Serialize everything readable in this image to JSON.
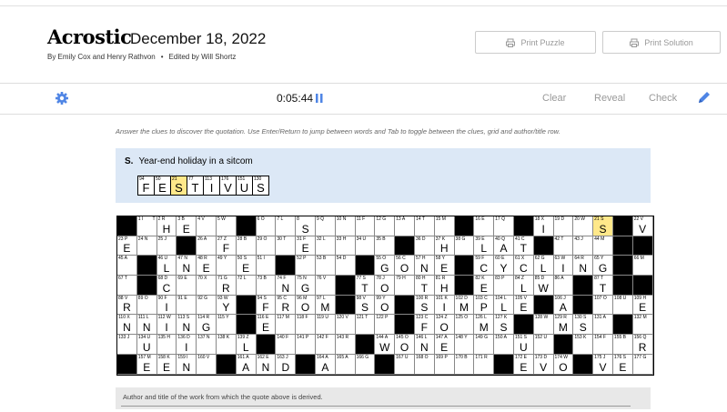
{
  "header": {
    "title": "Acrostic",
    "date": "December 18, 2022",
    "authors": "By Emily Cox and Henry Rathvon",
    "editor": "Edited by Will Shortz",
    "print_puzzle": "Print Puzzle",
    "print_solution": "Print Solution"
  },
  "toolbar": {
    "timer": "0:05:44",
    "clear": "Clear",
    "reveal": "Reveal",
    "check": "Check"
  },
  "instructions": "Answer the clues to discover the quotation. Use Enter/Return to jump between words and Tab to toggle between the clues, grid and author/title row.",
  "clue": {
    "letter": "S.",
    "text": "Year-end holiday in a sitcom",
    "cells": [
      {
        "num": "94",
        "letter": "F",
        "hl": false
      },
      {
        "num": "50",
        "letter": "E",
        "hl": false
      },
      {
        "num": "21",
        "letter": "S",
        "hl": true
      },
      {
        "num": "77",
        "letter": "T",
        "hl": false
      },
      {
        "num": "113",
        "letter": "I",
        "hl": false
      },
      {
        "num": "176",
        "letter": "V",
        "hl": false
      },
      {
        "num": "151",
        "letter": "U",
        "hl": false
      },
      {
        "num": "130",
        "letter": "S",
        "hl": false
      }
    ]
  },
  "grid_rows": [
    [
      [
        "B",
        "",
        ""
      ],
      [
        "1 I",
        "",
        "T"
      ],
      [
        "2 R",
        "H",
        ""
      ],
      [
        "3 B",
        "E",
        ""
      ],
      [
        "4 V",
        "",
        ""
      ],
      [
        "5 W",
        "",
        ""
      ],
      [
        "B",
        "",
        ""
      ],
      [
        "6 O",
        "",
        ""
      ],
      [
        "7 L",
        "",
        ""
      ],
      [
        "8",
        "S",
        ""
      ],
      [
        "9 Q",
        "",
        ""
      ],
      [
        "10 N",
        "",
        ""
      ],
      [
        "11 F",
        "",
        ""
      ],
      [
        "12 G",
        "",
        ""
      ],
      [
        "13 A",
        "",
        ""
      ],
      [
        "14 T",
        "",
        ""
      ],
      [
        "15 M",
        "",
        ""
      ],
      [
        "B",
        "",
        ""
      ],
      [
        "16 E",
        "",
        ""
      ],
      [
        "17 Q",
        "",
        ""
      ],
      [
        "B",
        "",
        ""
      ],
      [
        "18 X",
        "I",
        ""
      ],
      [
        "19 D",
        "",
        ""
      ],
      [
        "20 W",
        "",
        ""
      ],
      [
        "21 S",
        "S",
        "",
        1
      ],
      [
        "B",
        "",
        ""
      ],
      [
        "22 V",
        "V",
        ""
      ]
    ],
    [
      [
        "23 P",
        "E",
        ""
      ],
      [
        "24 N",
        "",
        ""
      ],
      [
        "25 J",
        "",
        ""
      ],
      [
        "B",
        "",
        ""
      ],
      [
        "26 A",
        "",
        ""
      ],
      [
        "27 Z",
        "F",
        ""
      ],
      [
        "28 B",
        "",
        ""
      ],
      [
        "29 O",
        "",
        ""
      ],
      [
        "30 T",
        "",
        ""
      ],
      [
        "31 F",
        "E",
        ""
      ],
      [
        "32 L",
        "",
        ""
      ],
      [
        "33 H",
        "",
        ""
      ],
      [
        "34 U",
        "",
        ""
      ],
      [
        "35 B",
        "",
        ""
      ],
      [
        "B",
        "",
        ""
      ],
      [
        "36 D",
        "",
        ""
      ],
      [
        "37 K",
        "H",
        ""
      ],
      [
        "38 G",
        "",
        ""
      ],
      [
        "39 E",
        "L",
        ""
      ],
      [
        "40 Q",
        "A",
        ""
      ],
      [
        "41 C",
        "T",
        ""
      ],
      [
        "B",
        "",
        ""
      ],
      [
        "42 T",
        "",
        ""
      ],
      [
        "43 J",
        "",
        ""
      ],
      [
        "44 M",
        "",
        ""
      ],
      [
        "B",
        "",
        ""
      ],
      [
        "B",
        "",
        ""
      ]
    ],
    [
      [
        "45 A",
        "",
        ""
      ],
      [
        "B",
        "",
        ""
      ],
      [
        "46 U",
        "L",
        ""
      ],
      [
        "47 N",
        "N",
        ""
      ],
      [
        "48 R",
        "E",
        ""
      ],
      [
        "49 Y",
        "",
        ""
      ],
      [
        "50 S",
        "E",
        ""
      ],
      [
        "51 I",
        "",
        ""
      ],
      [
        "B",
        "",
        ""
      ],
      [
        "52 P",
        "",
        ""
      ],
      [
        "53 B",
        "",
        ""
      ],
      [
        "54 D",
        "",
        ""
      ],
      [
        "B",
        "",
        ""
      ],
      [
        "55 O",
        "G",
        ""
      ],
      [
        "56 C",
        "O",
        ""
      ],
      [
        "57 H",
        "N",
        ""
      ],
      [
        "58 Y",
        "E",
        ""
      ],
      [
        "B",
        "",
        ""
      ],
      [
        "59 F",
        "C",
        ""
      ],
      [
        "60 E",
        "Y",
        ""
      ],
      [
        "61 X",
        "C",
        ""
      ],
      [
        "62 G",
        "L",
        ""
      ],
      [
        "63 W",
        "I",
        ""
      ],
      [
        "64 R",
        "N",
        ""
      ],
      [
        "65 Y",
        "G",
        ""
      ],
      [
        "B",
        "",
        ""
      ],
      [
        "66 M",
        "",
        ""
      ]
    ],
    [
      [
        "67 T",
        "",
        ""
      ],
      [
        "B",
        "",
        ""
      ],
      [
        "68 D",
        "C",
        ""
      ],
      [
        "69 E",
        "",
        ""
      ],
      [
        "70 X",
        "",
        ""
      ],
      [
        "71 G",
        "R",
        ""
      ],
      [
        "72 L",
        "",
        ""
      ],
      [
        "73 B",
        "",
        ""
      ],
      [
        "74 F",
        "N",
        ""
      ],
      [
        "75 N",
        "G",
        ""
      ],
      [
        "76 V",
        "",
        ""
      ],
      [
        "B",
        "",
        ""
      ],
      [
        "77 S",
        "T",
        ""
      ],
      [
        "78 J",
        "O",
        ""
      ],
      [
        "79 H",
        "",
        ""
      ],
      [
        "80 H",
        "T",
        ""
      ],
      [
        "81 R",
        "H",
        ""
      ],
      [
        "B",
        "",
        ""
      ],
      [
        "82 K",
        "E",
        ""
      ],
      [
        "83 P",
        "",
        ""
      ],
      [
        "84 Z",
        "L",
        ""
      ],
      [
        "85 D",
        "W",
        ""
      ],
      [
        "86 A",
        "",
        ""
      ],
      [
        "B",
        "",
        ""
      ],
      [
        "87 T",
        "T",
        ""
      ],
      [
        "B",
        "",
        ""
      ],
      [
        "B",
        "",
        ""
      ]
    ],
    [
      [
        "88 V",
        "R",
        ""
      ],
      [
        "89 O",
        "",
        ""
      ],
      [
        "90 F",
        "I",
        ""
      ],
      [
        "91 E",
        "",
        ""
      ],
      [
        "92 G",
        "",
        ""
      ],
      [
        "93 W",
        "Y",
        ""
      ],
      [
        "B",
        "",
        ""
      ],
      [
        "94 S",
        "F",
        ""
      ],
      [
        "95 C",
        "R",
        ""
      ],
      [
        "96 M",
        "O",
        ""
      ],
      [
        "97 L",
        "M",
        ""
      ],
      [
        "B",
        "",
        ""
      ],
      [
        "98 V",
        "S",
        ""
      ],
      [
        "99 Y",
        "O",
        ""
      ],
      [
        "B",
        "",
        ""
      ],
      [
        "100 R",
        "S",
        ""
      ],
      [
        "101 K",
        "I",
        ""
      ],
      [
        "102 D",
        "M",
        ""
      ],
      [
        "103 C",
        "P",
        ""
      ],
      [
        "104 L",
        "L",
        ""
      ],
      [
        "105 V",
        "E",
        ""
      ],
      [
        "B",
        "",
        ""
      ],
      [
        "106 J",
        "A",
        ""
      ],
      [
        "B",
        "",
        ""
      ],
      [
        "107 O",
        "",
        ""
      ],
      [
        "108 U",
        "",
        ""
      ],
      [
        "109 H",
        "E",
        ""
      ]
    ],
    [
      [
        "110 X",
        "N",
        ""
      ],
      [
        "111 L",
        "N",
        ""
      ],
      [
        "112 W",
        "I",
        ""
      ],
      [
        "113 S",
        "N",
        ""
      ],
      [
        "114 R",
        "G",
        ""
      ],
      [
        "115 Y",
        "",
        ""
      ],
      [
        "B",
        "",
        ""
      ],
      [
        "116 E",
        "E",
        ""
      ],
      [
        "117 M",
        "",
        ""
      ],
      [
        "118 F",
        "",
        ""
      ],
      [
        "119 U",
        "",
        ""
      ],
      [
        "120 V",
        "",
        ""
      ],
      [
        "121 T",
        "",
        ""
      ],
      [
        "122 P",
        "",
        ""
      ],
      [
        "B",
        "",
        ""
      ],
      [
        "123 C",
        "F",
        ""
      ],
      [
        "124 Z",
        "O",
        ""
      ],
      [
        "125 O",
        "",
        ""
      ],
      [
        "126 L",
        "M",
        ""
      ],
      [
        "127 K",
        "S",
        ""
      ],
      [
        "B",
        "",
        ""
      ],
      [
        "128 W",
        "",
        ""
      ],
      [
        "129 R",
        "M",
        ""
      ],
      [
        "130 S",
        "S",
        ""
      ],
      [
        "131 A",
        "",
        ""
      ],
      [
        "B",
        "",
        ""
      ],
      [
        "132 M",
        "",
        ""
      ]
    ],
    [
      [
        "133 J",
        "",
        ""
      ],
      [
        "134 U",
        "U",
        ""
      ],
      [
        "135 H",
        "",
        ""
      ],
      [
        "136 D",
        "I",
        ""
      ],
      [
        "137 N",
        "",
        ""
      ],
      [
        "138 K",
        "",
        ""
      ],
      [
        "139 Z",
        "L",
        ""
      ],
      [
        "B",
        "",
        ""
      ],
      [
        "140 F",
        "",
        ""
      ],
      [
        "141 P",
        "",
        ""
      ],
      [
        "142 F",
        "",
        ""
      ],
      [
        "143 R",
        "",
        ""
      ],
      [
        "B",
        "",
        ""
      ],
      [
        "144 A",
        "W",
        ""
      ],
      [
        "145 O",
        "O",
        ""
      ],
      [
        "146 L",
        "N",
        ""
      ],
      [
        "147 A",
        "E",
        ""
      ],
      [
        "148 Y",
        "",
        ""
      ],
      [
        "149 G",
        "",
        ""
      ],
      [
        "150 A",
        "",
        ""
      ],
      [
        "151 S",
        "U",
        ""
      ],
      [
        "152 U",
        "",
        ""
      ],
      [
        "B",
        "",
        ""
      ],
      [
        "153 K",
        "",
        ""
      ],
      [
        "154 F",
        "",
        ""
      ],
      [
        "155 B",
        "",
        ""
      ],
      [
        "156 Q",
        "R",
        ""
      ]
    ],
    [
      [
        "B",
        "",
        ""
      ],
      [
        "157 M",
        "E",
        ""
      ],
      [
        "158 K",
        "E",
        ""
      ],
      [
        "159 I",
        "N",
        ""
      ],
      [
        "160 V",
        "",
        ""
      ],
      [
        "B",
        "",
        ""
      ],
      [
        "161 A",
        "A",
        ""
      ],
      [
        "162 E",
        "N",
        ""
      ],
      [
        "163 J",
        "D",
        ""
      ],
      [
        "B",
        "",
        ""
      ],
      [
        "164 A",
        "A",
        ""
      ],
      [
        "165 A",
        "",
        ""
      ],
      [
        "166 G",
        "",
        ""
      ],
      [
        "B",
        "",
        ""
      ],
      [
        "167 U",
        "",
        ""
      ],
      [
        "168 O",
        "",
        ""
      ],
      [
        "169 P",
        "",
        ""
      ],
      [
        "170 B",
        "",
        ""
      ],
      [
        "171 R",
        "",
        ""
      ],
      [
        "B",
        "",
        ""
      ],
      [
        "172 E",
        "E",
        ""
      ],
      [
        "173 D",
        "V",
        ""
      ],
      [
        "174 W",
        "O",
        ""
      ],
      [
        "B",
        "",
        ""
      ],
      [
        "175 J",
        "V",
        ""
      ],
      [
        "176 S",
        "E",
        ""
      ],
      [
        "177 G",
        "",
        ""
      ]
    ]
  ],
  "author_box": "Author and title of the work from which the quote above is derived.",
  "icons": {
    "settings": "gear-icon",
    "pause": "pause-icon",
    "edit": "pencil-icon",
    "printer": "printer-icon"
  },
  "colors": {
    "accent": "#4f85e5",
    "highlight": "#ffe88a",
    "clue_bg": "#dce8f6"
  }
}
